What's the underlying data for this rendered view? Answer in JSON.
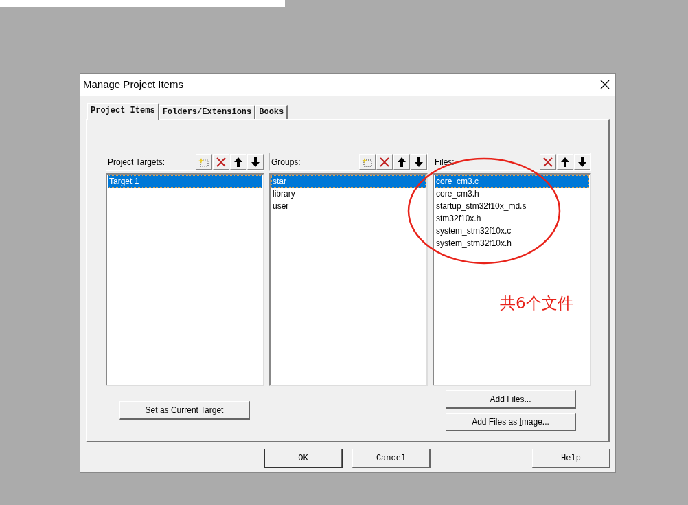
{
  "window": {
    "title": "Manage Project Items"
  },
  "tabs": [
    {
      "label": "Project Items",
      "selected": true
    },
    {
      "label": "Folders/Extensions",
      "selected": false
    },
    {
      "label": "Books",
      "selected": false
    }
  ],
  "lists": [
    {
      "title": "Project Targets:",
      "tools": [
        {
          "kind": "new"
        },
        {
          "kind": "delete"
        },
        {
          "kind": "up"
        },
        {
          "kind": "down"
        }
      ],
      "items": [
        {
          "label": "Target 1",
          "selected": true
        }
      ],
      "buttons": [
        {
          "parts": [
            {
              "text": "S",
              "underlined": true
            },
            {
              "text": "et as Current Target",
              "underlined": false
            }
          ]
        }
      ]
    },
    {
      "title": "Groups:",
      "tools": [
        {
          "kind": "new"
        },
        {
          "kind": "delete"
        },
        {
          "kind": "up"
        },
        {
          "kind": "down"
        }
      ],
      "items": [
        {
          "label": "star",
          "selected": true
        },
        {
          "label": "library",
          "selected": false
        },
        {
          "label": "user",
          "selected": false
        }
      ]
    },
    {
      "title": "Files:",
      "tools": [
        {
          "kind": "delete"
        },
        {
          "kind": "up"
        },
        {
          "kind": "down"
        }
      ],
      "items": [
        {
          "label": "core_cm3.c",
          "selected": true
        },
        {
          "label": "core_cm3.h",
          "selected": false
        },
        {
          "label": "startup_stm32f10x_md.s",
          "selected": false
        },
        {
          "label": "stm32f10x.h",
          "selected": false
        },
        {
          "label": "system_stm32f10x.c",
          "selected": false
        },
        {
          "label": "system_stm32f10x.h",
          "selected": false
        }
      ],
      "buttons": [
        {
          "parts": [
            {
              "text": "A",
              "underlined": true
            },
            {
              "text": "dd Files...",
              "underlined": false
            }
          ]
        },
        {
          "parts": [
            {
              "text": "Add Files as ",
              "underlined": false
            },
            {
              "text": "I",
              "underlined": true
            },
            {
              "text": "mage...",
              "underlined": false
            }
          ]
        }
      ]
    }
  ],
  "footer_buttons": [
    {
      "label": "OK",
      "default": true
    },
    {
      "label": "Cancel",
      "default": false
    },
    {
      "label": "Help",
      "default": false
    }
  ],
  "annotation": {
    "text": "共6个文件"
  }
}
